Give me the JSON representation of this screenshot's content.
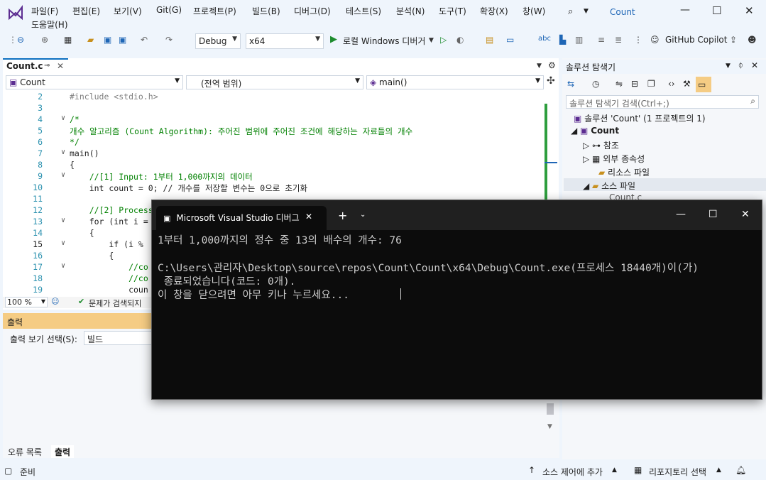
{
  "menu": {
    "items": [
      "파일(F)",
      "편집(E)",
      "보기(V)",
      "Git(G)",
      "프로젝트(P)",
      "빌드(B)",
      "디버그(D)",
      "테스트(S)",
      "분석(N)",
      "도구(T)",
      "확장(X)",
      "창(W)",
      "도움말(H)"
    ],
    "title": "Count"
  },
  "toolbar": {
    "config": "Debug",
    "platform": "x64",
    "run_label": "로컬 Windows 디버거",
    "copilot": "GitHub Copilot"
  },
  "editor": {
    "tab": "Count.c",
    "nav_project": "Count",
    "nav_scope": "(전역 범위)",
    "nav_member": "main()",
    "zoom": "100 %",
    "issues": "문제가 검색되지",
    "lines": [
      {
        "n": "2",
        "t": "#include <stdio.h>"
      },
      {
        "n": "3",
        "t": ""
      },
      {
        "n": "4",
        "t": "/*"
      },
      {
        "n": "5",
        "t": "개수 알고리즘 (Count Algorithm): 주어진 범위에 주어진 조건에 해당하는 자료들의 개수"
      },
      {
        "n": "6",
        "t": "*/"
      },
      {
        "n": "7",
        "t": "main()"
      },
      {
        "n": "8",
        "t": "{"
      },
      {
        "n": "9",
        "t": "    //[1] Input: 1부터 1,000까지의 데이터"
      },
      {
        "n": "10",
        "t": "    int count = 0; // 개수를 저장할 변수는 0으로 초기화"
      },
      {
        "n": "11",
        "t": ""
      },
      {
        "n": "12",
        "t": "    //[2] Process"
      },
      {
        "n": "13",
        "t": "    for (int i ="
      },
      {
        "n": "14",
        "t": "    {"
      },
      {
        "n": "15",
        "t": "        if (i %"
      },
      {
        "n": "16",
        "t": "        {"
      },
      {
        "n": "17",
        "t": "            //co"
      },
      {
        "n": "18",
        "t": "            //co"
      },
      {
        "n": "19",
        "t": "            coun"
      }
    ]
  },
  "output": {
    "title": "출력",
    "select_label": "출력 보기 선택(S):",
    "select_value": "빌드",
    "tabs": [
      "오류 목록",
      "출력"
    ]
  },
  "solution": {
    "title": "솔루션 탐색기",
    "search_placeholder": "솔루션 탐색기 검색(Ctrl+;)",
    "root": "솔루션 'Count' (1 프로젝트의 1)",
    "project": "Count",
    "items": [
      "참조",
      "외부 종속성",
      "리소스 파일",
      "소스 파일",
      "Count.c"
    ]
  },
  "terminal": {
    "tab_title": "Microsoft Visual Studio 디버그",
    "lines": [
      "1부터 1,000까지의 정수 중 13의 배수의 개수: 76",
      "",
      "C:\\Users\\관리자\\Desktop\\source\\repos\\Count\\Count\\x64\\Debug\\Count.exe(프로세스 18440개)이(가)",
      " 종료되었습니다(코드: 0개).",
      "이 창을 닫으려면 아무 키나 누르세요..."
    ]
  },
  "status": {
    "ready": "준비",
    "source_control": "소스 제어에 추가",
    "repo": "리포지토리 선택"
  }
}
